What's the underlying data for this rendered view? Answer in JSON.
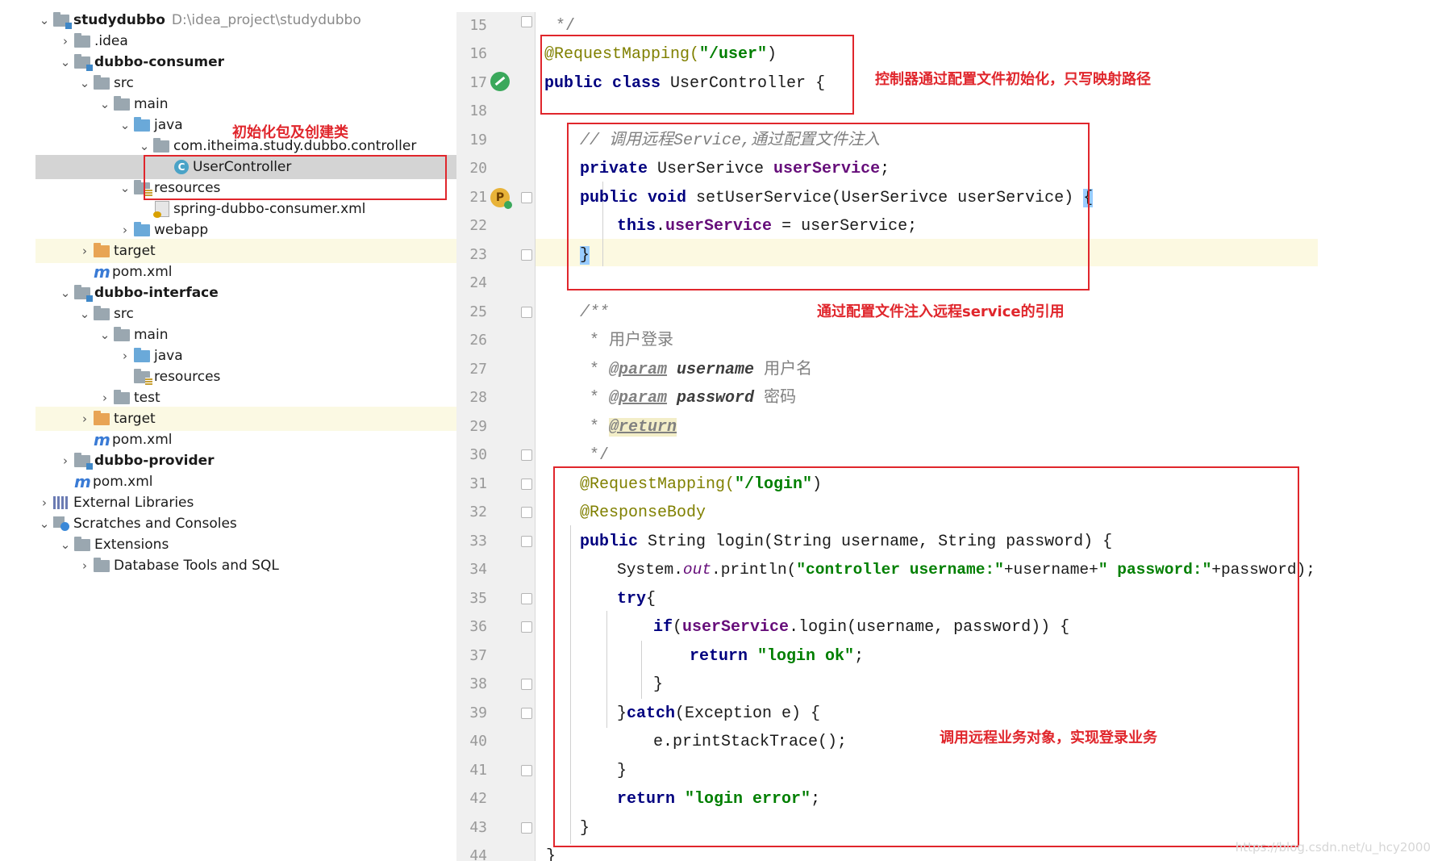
{
  "project_tree": {
    "rows": [
      {
        "label": "studydubbo",
        "path": "D:\\idea_project\\studydubbo"
      },
      {
        "label": ".idea"
      },
      {
        "label": "dubbo-consumer"
      },
      {
        "label": "src"
      },
      {
        "label": "main"
      },
      {
        "label": "java"
      },
      {
        "label": "com.itheima.study.dubbo.controller"
      },
      {
        "label": "UserController"
      },
      {
        "label": "resources"
      },
      {
        "label": "spring-dubbo-consumer.xml"
      },
      {
        "label": "webapp"
      },
      {
        "label": "target"
      },
      {
        "label": "pom.xml"
      },
      {
        "label": "dubbo-interface"
      },
      {
        "label": "src"
      },
      {
        "label": "main"
      },
      {
        "label": "java"
      },
      {
        "label": "resources"
      },
      {
        "label": "test"
      },
      {
        "label": "target"
      },
      {
        "label": "pom.xml"
      },
      {
        "label": "dubbo-provider"
      },
      {
        "label": "pom.xml"
      },
      {
        "label": "External Libraries"
      },
      {
        "label": "Scratches and Consoles"
      },
      {
        "label": "Extensions"
      },
      {
        "label": "Database Tools and SQL"
      }
    ],
    "icons": {
      "class_icon_letter": "C",
      "maven_icon_letter": "m"
    }
  },
  "editor": {
    "line_numbers": [
      "15",
      "16",
      "17",
      "18",
      "19",
      "20",
      "21",
      "22",
      "23",
      "24",
      "25",
      "26",
      "27",
      "28",
      "29",
      "30",
      "31",
      "32",
      "33",
      "34",
      "35",
      "36",
      "37",
      "38",
      "39",
      "40",
      "41",
      "42",
      "43",
      "44"
    ],
    "gutter_icon_letter": "P",
    "code": {
      "l15": "*/",
      "l16_ann": "@RequestMapping(",
      "l16_str": "\"/user\"",
      "l16_end": ")",
      "l17_kw": "public class",
      "l17_rest": " UserController {",
      "l19": "// 调用远程Service,通过配置文件注入",
      "l20_kw": "private",
      "l20_type": " UserSerivce ",
      "l20_fld": "userService",
      "l20_end": ";",
      "l21_kw": "public void",
      "l21_rest": " setUserService(UserSerivce userService) ",
      "l21_brace": "{",
      "l22_kw": "this",
      "l22_dot": ".",
      "l22_fld": "userService",
      "l22_rest": " = userService;",
      "l23": "}",
      "l25": "/**",
      "l26": "* 用户登录",
      "l27_star": "* ",
      "l27_tag": "@param",
      "l27_name": " username",
      "l27_desc": " 用户名",
      "l28_star": "* ",
      "l28_tag": "@param",
      "l28_name": " password",
      "l28_desc": " 密码",
      "l29_star": "* ",
      "l29_tag": "@return",
      "l30": "*/",
      "l31_ann": "@RequestMapping(",
      "l31_str": "\"/login\"",
      "l31_end": ")",
      "l32_ann": "@ResponseBody",
      "l33_kw": "public",
      "l33_rest": " String login(String username, String password) {",
      "l34_a": "System.",
      "l34_out": "out",
      "l34_b": ".println(",
      "l34_s1": "\"controller username:\"",
      "l34_c": "+username+",
      "l34_s2": "\" password:\"",
      "l34_d": "+password);",
      "l35_kw": "try",
      "l35_rest": "{",
      "l36_kw": "if",
      "l36_a": "(",
      "l36_fld": "userService",
      "l36_rest": ".login(username, password)) {",
      "l37_kw": "return",
      "l37_sp": " ",
      "l37_str": "\"login ok\"",
      "l37_end": ";",
      "l38": "}",
      "l39_a": "}",
      "l39_kw": "catch",
      "l39_rest": "(Exception e) {",
      "l40": "e.printStackTrace();",
      "l41": "}",
      "l42_kw": "return",
      "l42_sp": " ",
      "l42_str": "\"login error\"",
      "l42_end": ";",
      "l43": "}",
      "l44": "}"
    }
  },
  "annotations": {
    "note_tree": "初始化包及创建类",
    "note_class": "控制器通过配置文件初始化，只写映射路径",
    "note_inject": "通过配置文件注入远程service的引用",
    "note_login": "调用远程业务对象，实现登录业务",
    "color": "#e0262c"
  },
  "watermark": "https://blog.csdn.net/u_hcy2000"
}
